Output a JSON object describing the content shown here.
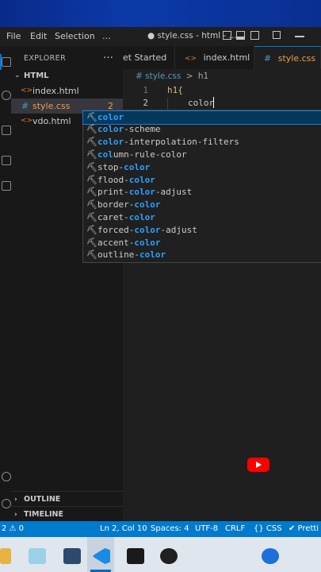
{
  "titlebar": {
    "menu": [
      "File",
      "Edit",
      "Selection",
      "…"
    ],
    "title": "● style.css - html - ..."
  },
  "sidebar": {
    "header": "EXPLORER",
    "more": "…",
    "folder": "HTML",
    "files": [
      {
        "name": "index.html",
        "icon": "<>",
        "badge": ""
      },
      {
        "name": "style.css",
        "icon": "#",
        "badge": "2"
      },
      {
        "name": "vdo.html",
        "icon": "<>",
        "badge": ""
      }
    ],
    "sections": [
      "OUTLINE",
      "TIMELINE"
    ]
  },
  "tabs": [
    {
      "label": "et Started",
      "icon": ""
    },
    {
      "label": "index.html",
      "icon": "<>"
    },
    {
      "label": "style.css",
      "icon": "#"
    }
  ],
  "editor": {
    "breadcrumb": [
      "# style.css",
      ">",
      "h1"
    ],
    "lines": [
      {
        "number": "1",
        "text": "h1{"
      },
      {
        "number": "2",
        "text": "color"
      }
    ]
  },
  "suggestions": [
    {
      "pre": "",
      "match": "color",
      "post": ""
    },
    {
      "pre": "",
      "match": "color",
      "post": "-scheme"
    },
    {
      "pre": "",
      "match": "color",
      "post": "-interpolation-filters"
    },
    {
      "pre": "",
      "match": "col",
      "post": "umn-rule-color"
    },
    {
      "pre": "stop-",
      "match": "color",
      "post": ""
    },
    {
      "pre": "flood-",
      "match": "color",
      "post": ""
    },
    {
      "pre": "print-",
      "match": "color",
      "post": "-adjust"
    },
    {
      "pre": "border-",
      "match": "color",
      "post": ""
    },
    {
      "pre": "caret-",
      "match": "color",
      "post": ""
    },
    {
      "pre": "forced-",
      "match": "color",
      "post": "-adjust"
    },
    {
      "pre": "accent-",
      "match": "color",
      "post": ""
    },
    {
      "pre": "outline-",
      "match": "color",
      "post": ""
    }
  ],
  "statusbar": {
    "problems": "2 ⚠ 0",
    "position": "Ln 2, Col 10",
    "spaces": "Spaces: 4",
    "encoding": "UTF-8",
    "eol": "CRLF",
    "language": "{} CSS",
    "formatter": "✔ Pretti"
  },
  "colors": {
    "accent": "#007acc",
    "match_highlight": "#2aa1ff",
    "active_tab_text": "#e8a04a"
  }
}
